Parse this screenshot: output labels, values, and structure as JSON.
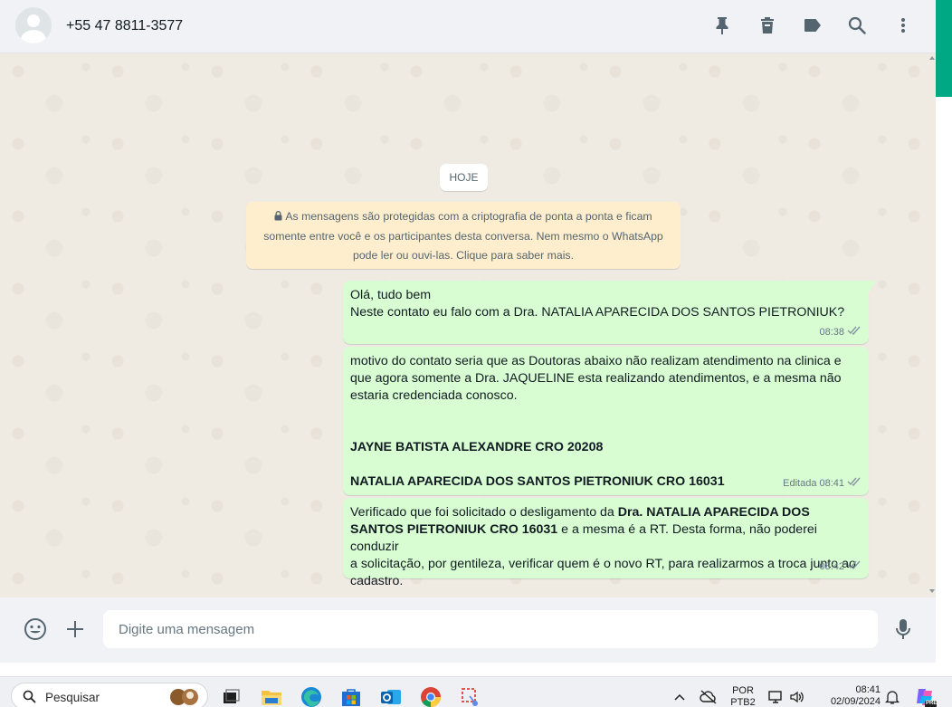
{
  "header": {
    "contact_name": "+55 47 8811-3577",
    "icons": [
      "pin-icon",
      "delete-icon",
      "label-icon",
      "search-icon",
      "menu-icon"
    ]
  },
  "chat": {
    "date_label": "HOJE",
    "encryption_notice": {
      "lines": [
        "As mensagens são protegidas com a criptografia de ponta a ponta e ficam",
        "somente entre você e os participantes desta conversa. Nem mesmo o WhatsApp",
        "pode ler ou ouvi-las. Clique para saber mais."
      ]
    },
    "messages": [
      {
        "lines": [
          "Olá, tudo bem",
          "Neste contato eu falo com a Dra. NATALIA APARECIDA DOS SANTOS PIETRONIUK?"
        ],
        "time": "08:38",
        "edited": ""
      },
      {
        "lines": [
          "motivo do contato seria que as Doutoras abaixo não realizam atendimento na clinica e",
          "que agora somente a Dra. JAQUELINE esta realizando atendimentos, e a mesma não",
          "estaria credenciada conosco."
        ],
        "bold_lines": [
          "JAYNE BATISTA ALEXANDRE CRO 20208",
          "NATALIA APARECIDA DOS SANTOS PIETRONIUK CRO 16031"
        ],
        "time": "08:41",
        "edited": "Editada"
      },
      {
        "segments": {
          "pre": "Verificado que foi solicitado o desligamento da ",
          "bold_a": "Dra. NATALIA APARECIDA DOS",
          "bold_b": "SANTOS PIETRONIUK CRO 16031",
          "post_a": " e a mesma é a RT. Desta forma, não poderei conduzir",
          "post_b": "a solicitação, por gentileza, verificar quem é o novo RT, para realizarmos a troca junto ao",
          "post_c": "cadastro."
        },
        "time": "08:42",
        "edited": ""
      }
    ]
  },
  "composer": {
    "placeholder": "Digite uma mensagem"
  },
  "taskbar": {
    "search_label": "Pesquisar",
    "language": "POR",
    "keyboard": "PTB2",
    "time": "08:41",
    "date": "02/09/2024",
    "badge": "PRE"
  },
  "colors": {
    "accent": "#00a884",
    "outgoing_bubble": "#d9fdd3",
    "notice_bg": "#ffeecd",
    "chat_bg": "#efeae2",
    "ticks": "#8696a0"
  }
}
